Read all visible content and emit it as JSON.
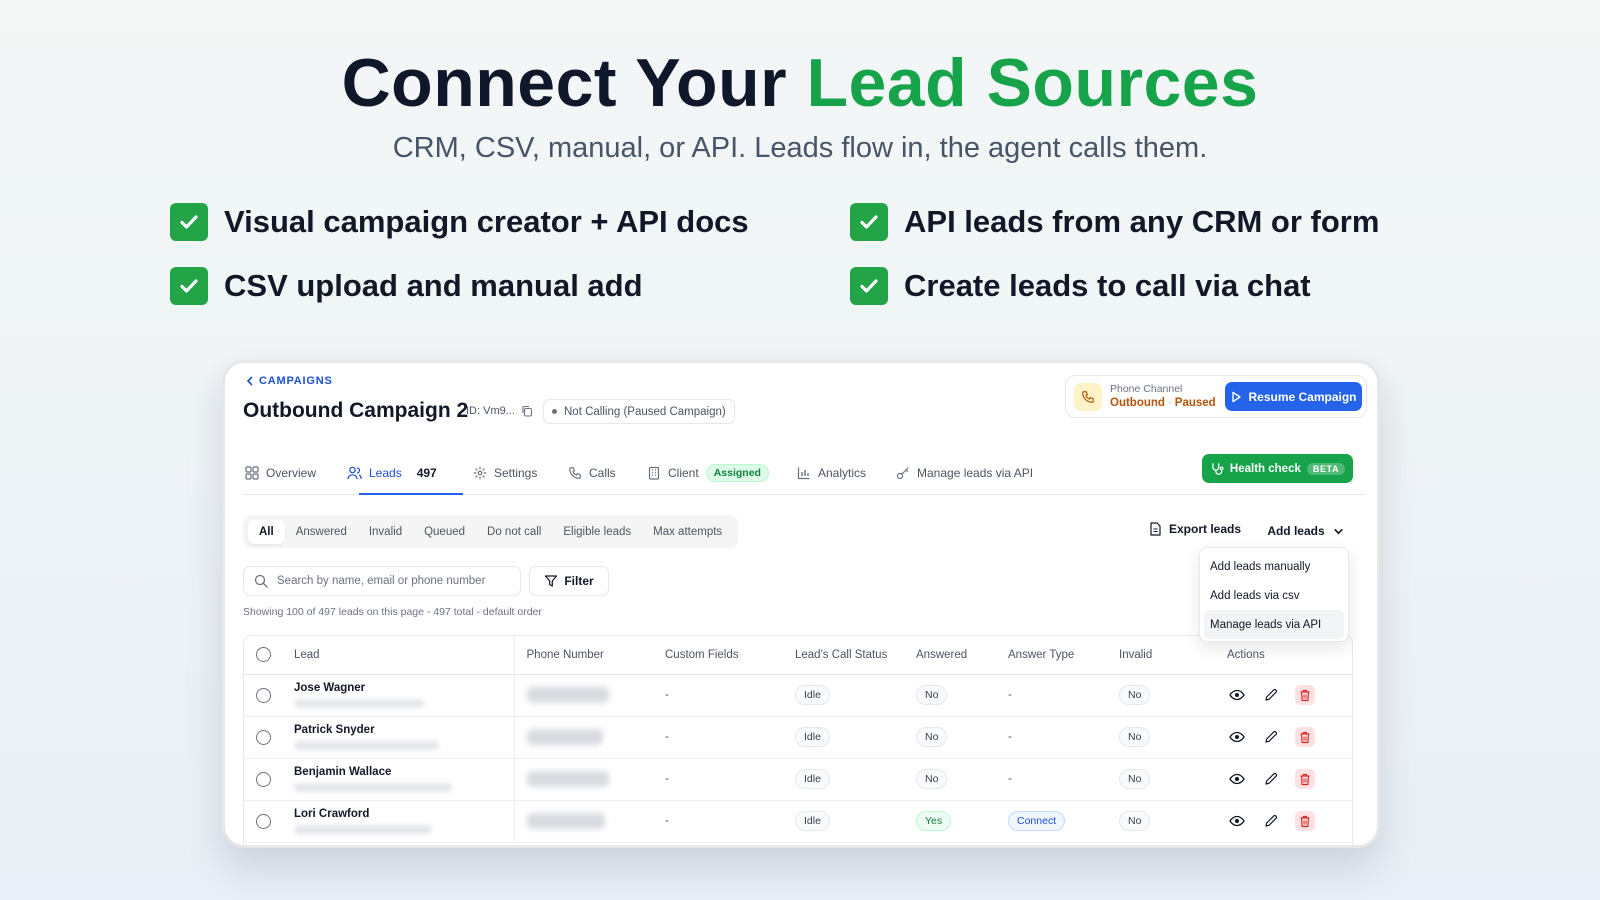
{
  "hero": {
    "title_main": "Connect Your ",
    "title_accent": "Lead Sources",
    "subtitle": "CRM, CSV, manual, or API. Leads flow in, the agent calls them.",
    "features": [
      "Visual campaign creator + API docs",
      "CSV upload and manual add",
      "API leads from any CRM or form",
      "Create leads to call via chat"
    ],
    "accent_color": "#16a34a",
    "check_color": "#22a447"
  },
  "app": {
    "back_label": "CAMPAIGNS",
    "title": "Outbound Campaign 2",
    "id_label": "ID: Vm9...",
    "status": "Not Calling (Paused Campaign)",
    "channel": {
      "label": "Phone Channel",
      "direction": "Outbound",
      "separator": "·",
      "state": "Paused"
    },
    "resume_label": "Resume Campaign",
    "tabs": {
      "overview": "Overview",
      "leads": "Leads",
      "leads_count": "497",
      "settings": "Settings",
      "calls": "Calls",
      "client": "Client",
      "client_badge": "Assigned",
      "analytics": "Analytics",
      "manage_api": "Manage leads via API"
    },
    "health": {
      "label": "Health check",
      "badge": "BETA"
    },
    "filters": [
      "All",
      "Answered",
      "Invalid",
      "Queued",
      "Do not call",
      "Eligible leads",
      "Max attempts"
    ],
    "export_label": "Export leads",
    "add_leads_label": "Add leads",
    "add_menu": [
      "Add leads manually",
      "Add leads via csv",
      "Manage leads via API"
    ],
    "search_placeholder": "Search by name, email or phone number",
    "filter_label": "Filter",
    "showing": "Showing 100 of 497 leads on this page - 497 total - default order",
    "columns": [
      "Lead",
      "Phone Number",
      "Custom Fields",
      "Lead's Call Status",
      "Answered",
      "Answer Type",
      "Invalid",
      "Actions"
    ],
    "rows": [
      {
        "name": "Jose Wagner",
        "custom": "-",
        "status": "Idle",
        "answered": "No",
        "answer_type": "-",
        "invalid": "No"
      },
      {
        "name": "Patrick Snyder",
        "custom": "-",
        "status": "Idle",
        "answered": "No",
        "answer_type": "-",
        "invalid": "No"
      },
      {
        "name": "Benjamin Wallace",
        "custom": "-",
        "status": "Idle",
        "answered": "No",
        "answer_type": "-",
        "invalid": "No"
      },
      {
        "name": "Lori Crawford",
        "custom": "-",
        "status": "Idle",
        "answered": "Yes",
        "answer_type": "Connect",
        "invalid": "No"
      }
    ],
    "primary_color": "#2563eb"
  }
}
